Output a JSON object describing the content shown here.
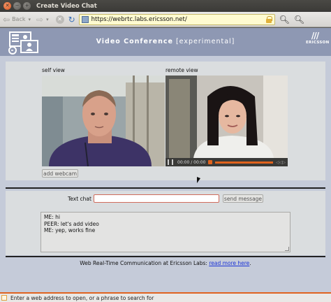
{
  "window": {
    "title": "Create Video Chat"
  },
  "toolbar": {
    "back_label": "Back",
    "url": "https://webrtc.labs.ericsson.net/"
  },
  "header": {
    "title": "Video Conference",
    "subtitle": "[experimental]",
    "brand": "ERICSSON"
  },
  "video": {
    "self_label": "self view",
    "remote_label": "remote view",
    "add_webcam_label": "add webcam",
    "time": "00:00 / 00:00"
  },
  "chat": {
    "label": "Text chat",
    "input_value": "",
    "send_label": "send message",
    "messages": [
      "ME: hi",
      "PEER: let's add video",
      "ME: yep, works fine"
    ]
  },
  "footer": {
    "text": "Web Real-Time Communication at Ericsson Labs: ",
    "link": "read more here",
    "suffix": "."
  },
  "status": {
    "text": "Enter a web address to open, or a phrase to search for"
  },
  "colors": {
    "accent": "#e0631e",
    "header": "#8e98b3",
    "page": "#c5cbd9",
    "link": "#1a33d6"
  }
}
